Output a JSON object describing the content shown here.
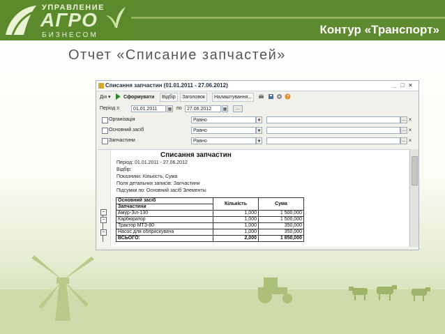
{
  "header": {
    "logo_top": "УПРАВЛЕНИЕ",
    "logo_mid": "АГРО",
    "logo_bot": "БИЗНЕСОМ",
    "brand_right": "Контур «Транспорт»",
    "slide_title": "Отчет «Списание запчастей»"
  },
  "window": {
    "title": "Списання запчастин (01.01.2011 - 27.06.2012)",
    "toolbar": {
      "actions": "Дія ▾",
      "generate": "Сформувати",
      "filter": "Відбір",
      "header": "Заголовок",
      "settings": "Налаштування..."
    },
    "period": {
      "label": "Період з:",
      "from": "01.01.2011",
      "to_label": "по",
      "to": "27.06.2012",
      "more": "..."
    },
    "filters": [
      {
        "label": "Організація",
        "condition": "Равно"
      },
      {
        "label": "Основний засіб",
        "condition": "Равно"
      },
      {
        "label": "Запчастини",
        "condition": "Равно"
      }
    ]
  },
  "report": {
    "title": "Списання запчастин",
    "info": [
      "Період: 01.01.2011 - 27.06.2012",
      "Відбір:",
      "Показники:  Кількість, Сума",
      "Поля детальних записів:  Запчастини",
      "Підсумки по:  Основний засіб Элементы"
    ],
    "table": {
      "col_group": "Основний засіб",
      "col_item": "Запчастини",
      "col_qty": "Кількість",
      "col_sum": "Сума",
      "rows": [
        {
          "name": "Амур-Зіл-130",
          "qty": "1,000",
          "sum": "1 500,000"
        },
        {
          "name": "Карбюратор",
          "qty": "1,000",
          "sum": "1 500,000"
        },
        {
          "name": "Трактор МТЗ-80",
          "qty": "1,000",
          "sum": "350,000"
        },
        {
          "name": "Насос для обприскувача",
          "qty": "1,000",
          "sum": "350,000"
        }
      ],
      "total": {
        "name": "ВСЬОГО:",
        "qty": "2,000",
        "sum": "1 850,000"
      }
    }
  },
  "colors": {
    "brand_green": "#5d8a2e",
    "window_bg": "#f1f1eb"
  }
}
